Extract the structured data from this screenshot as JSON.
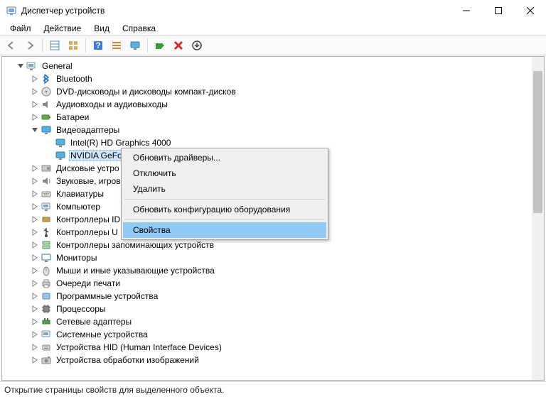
{
  "window": {
    "title": "Диспетчер устройств"
  },
  "menu": {
    "file": "Файл",
    "action": "Действие",
    "view": "Вид",
    "help": "Справка"
  },
  "tree": {
    "root": "General",
    "bluetooth": "Bluetooth",
    "dvd": "DVD-дисководы и дисководы компакт-дисков",
    "audio": "Аудиовходы и аудиовыходы",
    "battery": "Батареи",
    "video": "Видеоадаптеры",
    "video_intel": "Intel(R) HD Graphics 4000",
    "video_nvidia": "NVIDIA GeFo",
    "disk": "Дисковые устро",
    "sound": "Звуковые, игров",
    "keyboard": "Клавиатуры",
    "computer": "Компьютер",
    "ide": "Контроллеры ID",
    "usb": "Контроллеры U",
    "storage": "Контроллеры запоминающих устройств",
    "monitors": "Мониторы",
    "mice": "Мыши и иные указывающие устройства",
    "printq": "Очереди печати",
    "softdev": "Программные устройства",
    "cpu": "Процессоры",
    "net": "Сетевые адаптеры",
    "sys": "Системные устройства",
    "hid": "Устройства HID (Human Interface Devices)",
    "imaging": "Устройства обработки изображений"
  },
  "ctx": {
    "update": "Обновить драйверы...",
    "disable": "Отключить",
    "delete": "Удалить",
    "scan": "Обновить конфигурацию оборудования",
    "props": "Свойства"
  },
  "status": "Открытие страницы свойств для выделенного объекта."
}
